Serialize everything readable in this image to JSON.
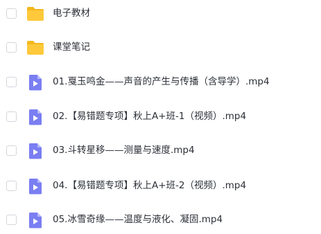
{
  "colors": {
    "folder": "#ffc93b",
    "folder_tab": "#f4b81d",
    "video": "#7a7ef2",
    "video_fold": "#b5b7fa",
    "text": "#2b2f36",
    "checkbox_border": "#d4d6dc"
  },
  "files": [
    {
      "type": "folder",
      "icon": "folder-icon",
      "name": "电子教材"
    },
    {
      "type": "folder",
      "icon": "folder-icon",
      "name": "课堂笔记"
    },
    {
      "type": "video",
      "icon": "video-file-icon",
      "name": "01.戛玉鸣金——声音的产生与传播（含导学）.mp4"
    },
    {
      "type": "video",
      "icon": "video-file-icon",
      "name": "02.【易错题专项】秋上A+班-1（视频）.mp4"
    },
    {
      "type": "video",
      "icon": "video-file-icon",
      "name": "03.斗转星移——测量与速度.mp4"
    },
    {
      "type": "video",
      "icon": "video-file-icon",
      "name": "04.【易错题专项】秋上A+班-2（视频）.mp4"
    },
    {
      "type": "video",
      "icon": "video-file-icon",
      "name": "05.冰雪奇缘——温度与液化、凝固.mp4"
    }
  ]
}
